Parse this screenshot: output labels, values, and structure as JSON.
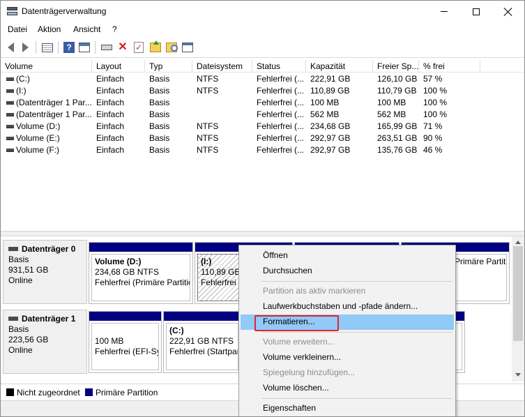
{
  "window": {
    "title": "Datenträgerverwaltung"
  },
  "menu": [
    "Datei",
    "Aktion",
    "Ansicht",
    "?"
  ],
  "columns": [
    "Volume",
    "Layout",
    "Typ",
    "Dateisystem",
    "Status",
    "Kapazität",
    "Freier Sp...",
    "% frei"
  ],
  "volumes": [
    [
      "(C:)",
      "Einfach",
      "Basis",
      "NTFS",
      "Fehlerfrei (...",
      "222,91 GB",
      "126,10 GB",
      "57 %"
    ],
    [
      "(I:)",
      "Einfach",
      "Basis",
      "NTFS",
      "Fehlerfrei (...",
      "110,89 GB",
      "110,79 GB",
      "100 %"
    ],
    [
      "(Datenträger 1 Par...",
      "Einfach",
      "Basis",
      "",
      "Fehlerfrei (...",
      "100 MB",
      "100 MB",
      "100 %"
    ],
    [
      "(Datenträger 1 Par...",
      "Einfach",
      "Basis",
      "",
      "Fehlerfrei (...",
      "562 MB",
      "562 MB",
      "100 %"
    ],
    [
      "Volume (D:)",
      "Einfach",
      "Basis",
      "NTFS",
      "Fehlerfrei (...",
      "234,68 GB",
      "165,99 GB",
      "71 %"
    ],
    [
      "Volume (E:)",
      "Einfach",
      "Basis",
      "NTFS",
      "Fehlerfrei (...",
      "292,97 GB",
      "263,51 GB",
      "90 %"
    ],
    [
      "Volume (F:)",
      "Einfach",
      "Basis",
      "NTFS",
      "Fehlerfrei (...",
      "292,97 GB",
      "135,76 GB",
      "46 %"
    ]
  ],
  "disks": [
    {
      "name": "Datenträger 0",
      "type": "Basis",
      "size": "931,51 GB",
      "state": "Online",
      "partitions": [
        {
          "name": "Volume  (D:)",
          "detail": "234,68 GB NTFS",
          "status": "Fehlerfrei (Primäre Partition"
        },
        {
          "name": "(I:)",
          "detail": "110,89 GB",
          "status": "Fehlerfrei"
        },
        {
          "name": "",
          "detail": "",
          "status": ""
        },
        {
          "name": "",
          "detail": "",
          "status": "Primäre Partition"
        }
      ]
    },
    {
      "name": "Datenträger 1",
      "type": "Basis",
      "size": "223,56 GB",
      "state": "Online",
      "partitions": [
        {
          "name": "",
          "detail": "100 MB",
          "status": "Fehlerfrei (EFI-Sys"
        },
        {
          "name": "(C:)",
          "detail": "222,91 GB NTFS",
          "status": "Fehlerfrei (Startpart"
        },
        {
          "name": "",
          "detail": "",
          "status": ""
        }
      ]
    }
  ],
  "legend": [
    {
      "label": "Nicht zugeordnet",
      "color": "#000000"
    },
    {
      "label": "Primäre Partition",
      "color": "#000080"
    }
  ],
  "context_menu": [
    {
      "label": "Öffnen",
      "enabled": true
    },
    {
      "label": "Durchsuchen",
      "enabled": true
    },
    {
      "label": "Partition als aktiv markieren",
      "enabled": false
    },
    {
      "label": "Laufwerkbuchstaben und -pfade ändern...",
      "enabled": true
    },
    {
      "label": "Formatieren...",
      "enabled": true,
      "highlighted": true
    },
    {
      "label": "Volume erweitern...",
      "enabled": false
    },
    {
      "label": "Volume verkleinern...",
      "enabled": true
    },
    {
      "label": "Spiegelung hinzufügen...",
      "enabled": false
    },
    {
      "label": "Volume löschen...",
      "enabled": true
    },
    {
      "label": "Eigenschaften",
      "enabled": true
    }
  ],
  "toolbar_icons": [
    "back-arrow-icon",
    "forward-arrow-icon",
    "list-view-icon",
    "help-icon",
    "properties-icon",
    "connect-drive-icon",
    "delete-icon",
    "check-icon",
    "up-folder-icon",
    "search-folder-icon",
    "window-icon"
  ],
  "colors": {
    "partition_bar": "#000080",
    "menu_highlight": "#91c9f7",
    "focus_outline": "#e0242e"
  }
}
